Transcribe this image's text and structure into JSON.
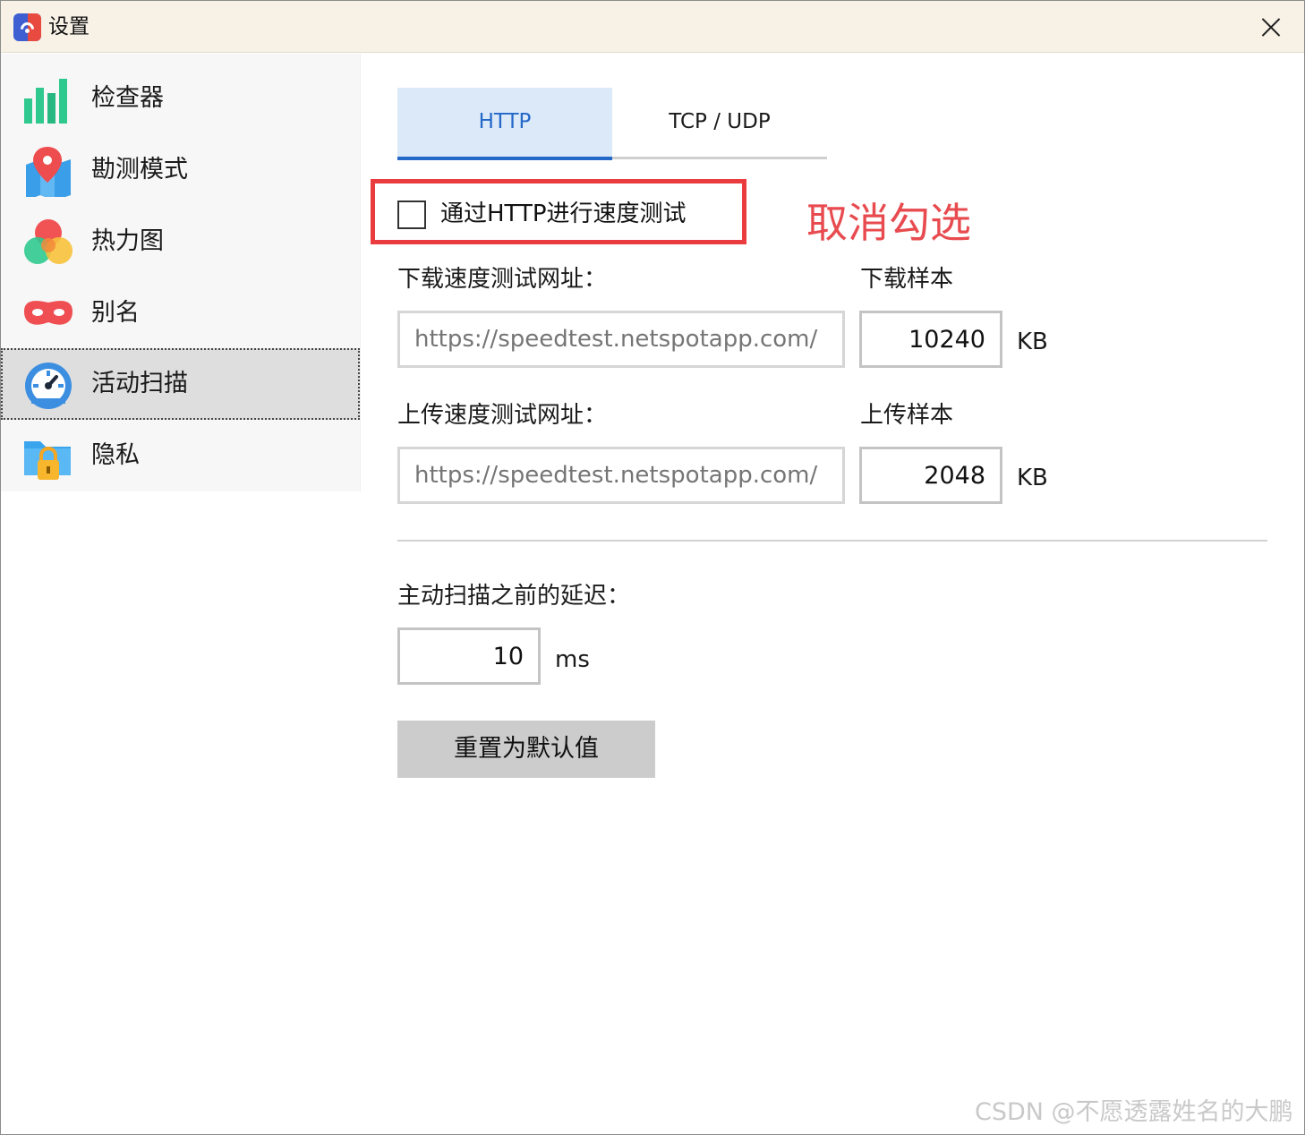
{
  "window": {
    "title": "设置"
  },
  "sidebar": {
    "items": [
      {
        "label": "检查器",
        "icon": "bar-chart-icon"
      },
      {
        "label": "勘测模式",
        "icon": "map-pin-icon"
      },
      {
        "label": "热力图",
        "icon": "heatmap-icon"
      },
      {
        "label": "别名",
        "icon": "mask-icon"
      },
      {
        "label": "活动扫描",
        "icon": "speedometer-icon",
        "active": true
      },
      {
        "label": "隐私",
        "icon": "lock-folder-icon"
      }
    ]
  },
  "tabs": [
    {
      "label": "HTTP",
      "active": true
    },
    {
      "label": "TCP / UDP",
      "active": false
    }
  ],
  "http": {
    "checkbox_label": "通过HTTP进行速度测试",
    "checked": false,
    "annotation": "取消勾选",
    "download_url_label": "下载速度测试网址：",
    "download_url_placeholder": "https://speedtest.netspotapp.com/",
    "download_sample_label": "下载样本",
    "download_sample_value": "10240",
    "download_unit": "KB",
    "upload_url_label": "上传速度测试网址：",
    "upload_url_placeholder": "https://speedtest.netspotapp.com/",
    "upload_sample_label": "上传样本",
    "upload_sample_value": "2048",
    "upload_unit": "KB"
  },
  "scan": {
    "delay_label": "主动扫描之前的延迟：",
    "delay_value": "10",
    "delay_unit": "ms",
    "reset_label": "重置为默认值"
  },
  "colors": {
    "accent": "#2468c8",
    "tab_active_bg": "#dbe9f8",
    "annotation_red": "#e84b4f",
    "titlebar_bg": "#f7f1e6"
  },
  "watermark": "CSDN @不愿透露姓名的大鹏"
}
